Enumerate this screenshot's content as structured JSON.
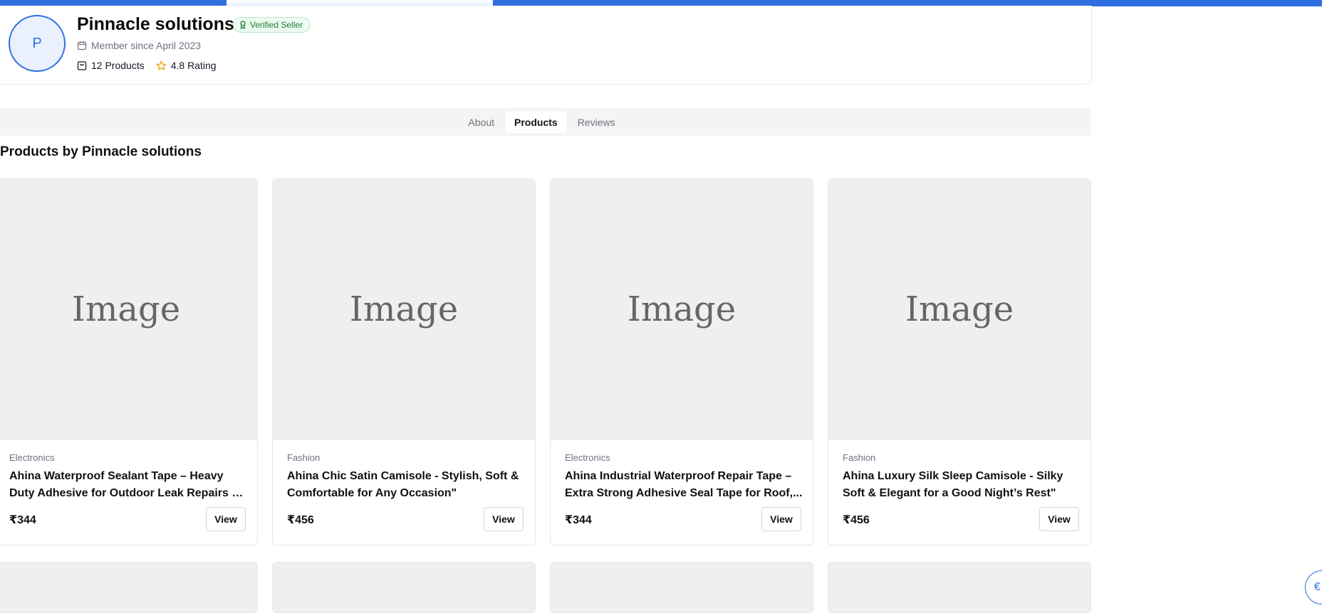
{
  "profile": {
    "avatar_initial": "P",
    "name": "Pinnacle solutions",
    "verified_label": "Verified Seller",
    "member_since": "Member since April 2023",
    "products_count": "12 Products",
    "rating": "4.8 Rating"
  },
  "tabs": [
    {
      "label": "About",
      "active": false
    },
    {
      "label": "Products",
      "active": true
    },
    {
      "label": "Reviews",
      "active": false
    }
  ],
  "section_title": "Products by Pinnacle solutions",
  "products": [
    {
      "image_label": "Image",
      "category": "Electronics",
      "title": "Ahina Waterproof Sealant Tape – Heavy Duty Adhesive for Outdoor Leak Repairs on Roof...",
      "price": "₹344",
      "button": "View"
    },
    {
      "image_label": "Image",
      "category": "Fashion",
      "title": "Ahina Chic Satin Camisole - Stylish, Soft & Comfortable for Any Occasion\"",
      "price": "₹456",
      "button": "View"
    },
    {
      "image_label": "Image",
      "category": "Electronics",
      "title": "Ahina Industrial Waterproof Repair Tape – Extra Strong Adhesive Seal Tape for Roof,...",
      "price": "₹344",
      "button": "View"
    },
    {
      "image_label": "Image",
      "category": "Fashion",
      "title": "Ahina Luxury Silk Sleep Camisole - Silky Soft & Elegant for a Good Night’s Rest\"",
      "price": "₹456",
      "button": "View"
    }
  ],
  "floating_button_glyph": "€",
  "colors": {
    "accent": "#2f6fe0",
    "verified_bg": "#ecfbef",
    "verified_text": "#1f7a3a",
    "star": "#e8a400"
  }
}
